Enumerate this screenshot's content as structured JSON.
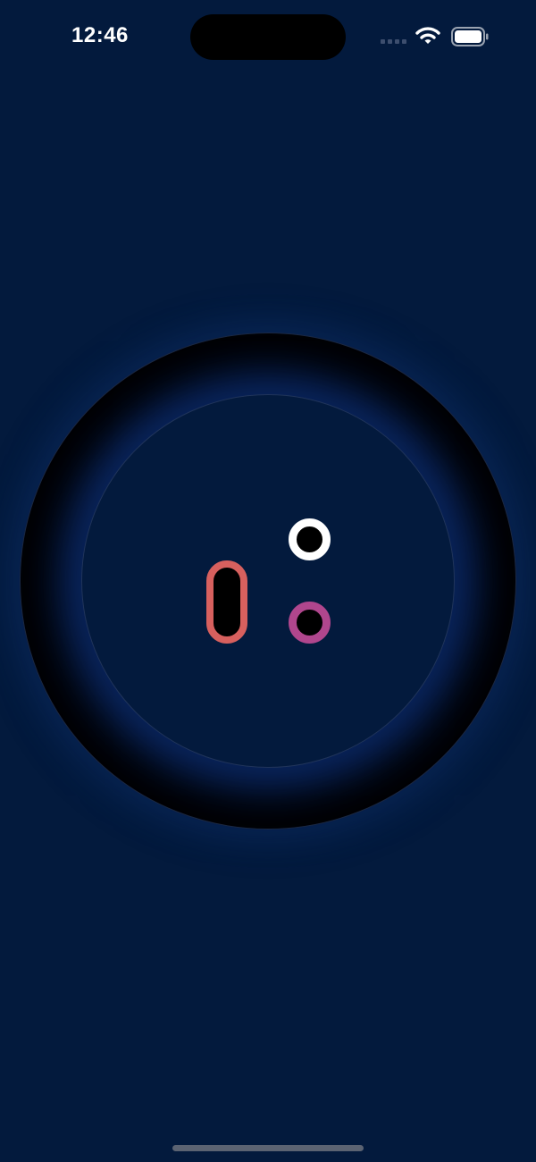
{
  "status_bar": {
    "time": "12:46",
    "signal_icon": "signal-dots-icon",
    "wifi_icon": "wifi-icon",
    "battery_icon": "battery-full-icon"
  },
  "colors": {
    "background": "#031a3d",
    "dial_ring": "#000000",
    "mouth_ring": "#d7605e",
    "eye_top_ring": "#ffffff",
    "eye_bottom_ring": "#b0468d",
    "home_indicator": "#5b6372"
  }
}
